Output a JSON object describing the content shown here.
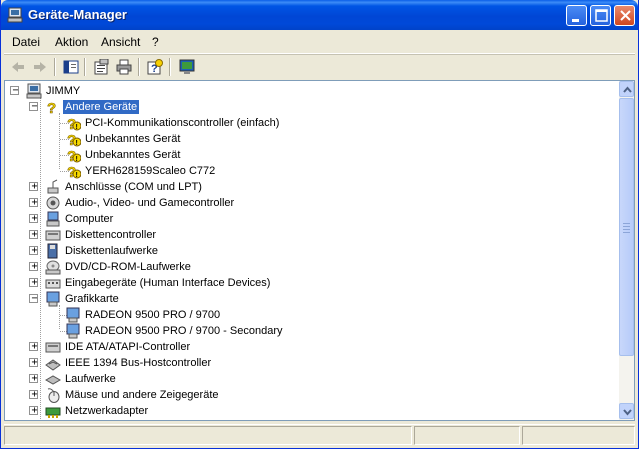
{
  "window": {
    "title": "Geräte-Manager"
  },
  "menu": [
    "Datei",
    "Aktion",
    "Ansicht",
    "?"
  ],
  "toolbar": [
    "back-icon",
    "forward-icon",
    "show-hide-console-tree-icon",
    "properties-icon",
    "print-icon",
    "help-icon",
    "computer-monitor-icon"
  ],
  "tree": {
    "root": "JIMMY",
    "other_devices": {
      "label": "Andere Geräte",
      "children": [
        "PCI-Kommunikationscontroller (einfach)",
        "Unbekanntes Gerät",
        "Unbekanntes Gerät",
        "YERH628159Scaleo C772"
      ]
    },
    "categories_a": [
      "Anschlüsse (COM und LPT)",
      "Audio-, Video- und Gamecontroller",
      "Computer",
      "Diskettencontroller",
      "Diskettenlaufwerke",
      "DVD/CD-ROM-Laufwerke",
      "Eingabegeräte (Human Interface Devices)"
    ],
    "graphics": {
      "label": "Grafikkarte",
      "children": [
        "RADEON 9500 PRO / 9700",
        "RADEON 9500 PRO / 9700 - Secondary"
      ]
    },
    "categories_b": [
      "IDE ATA/ATAPI-Controller",
      "IEEE 1394 Bus-Hostcontroller",
      "Laufwerke",
      "Mäuse und andere Zeigegeräte",
      "Netzwerkadapter"
    ]
  },
  "colors": {
    "selection": "#316ac5",
    "titlebar": "#0055e5"
  }
}
